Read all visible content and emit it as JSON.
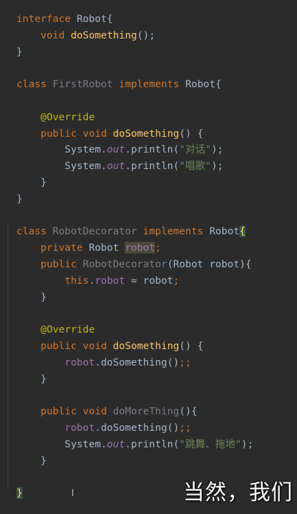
{
  "editor": {
    "lines": [
      [
        {
          "t": "interface",
          "c": "kw"
        },
        {
          "t": " Robot{",
          "c": "plain"
        }
      ],
      [
        {
          "t": "    ",
          "c": "plain"
        },
        {
          "t": "void",
          "c": "kw"
        },
        {
          "t": " ",
          "c": "plain"
        },
        {
          "t": "doSomething",
          "c": "fn"
        },
        {
          "t": "();",
          "c": "plain"
        }
      ],
      [
        {
          "t": "}",
          "c": "plain"
        }
      ],
      [],
      [
        {
          "t": "class",
          "c": "kw"
        },
        {
          "t": " ",
          "c": "plain"
        },
        {
          "t": "FirstRobot",
          "c": "unused"
        },
        {
          "t": " ",
          "c": "plain"
        },
        {
          "t": "implements",
          "c": "kw"
        },
        {
          "t": " Robot{",
          "c": "plain"
        }
      ],
      [],
      [
        {
          "t": "    ",
          "c": "plain"
        },
        {
          "t": "@Override",
          "c": "ann"
        }
      ],
      [
        {
          "t": "    ",
          "c": "plain"
        },
        {
          "t": "public",
          "c": "kw"
        },
        {
          "t": " ",
          "c": "plain"
        },
        {
          "t": "void",
          "c": "kw"
        },
        {
          "t": " ",
          "c": "plain"
        },
        {
          "t": "doSomething",
          "c": "fn"
        },
        {
          "t": "() {",
          "c": "plain"
        }
      ],
      [
        {
          "t": "        System.",
          "c": "plain"
        },
        {
          "t": "out",
          "c": "fld-i"
        },
        {
          "t": ".println(",
          "c": "plain"
        },
        {
          "t": "\"对话\"",
          "c": "str"
        },
        {
          "t": ");",
          "c": "plain"
        }
      ],
      [
        {
          "t": "        System.",
          "c": "plain"
        },
        {
          "t": "out",
          "c": "fld-i"
        },
        {
          "t": ".println(",
          "c": "plain"
        },
        {
          "t": "\"唱歌\"",
          "c": "str"
        },
        {
          "t": ");",
          "c": "plain"
        }
      ],
      [
        {
          "t": "    }",
          "c": "plain"
        }
      ],
      [
        {
          "t": "}",
          "c": "plain"
        }
      ],
      [],
      [
        {
          "t": "class",
          "c": "kw"
        },
        {
          "t": " ",
          "c": "plain"
        },
        {
          "t": "RobotDecorator",
          "c": "unused"
        },
        {
          "t": " ",
          "c": "plain"
        },
        {
          "t": "implements",
          "c": "kw"
        },
        {
          "t": " Robot",
          "c": "plain"
        },
        {
          "t": "{",
          "c": "caret-brace"
        }
      ],
      [
        {
          "t": "    ",
          "c": "plain"
        },
        {
          "t": "private",
          "c": "kw"
        },
        {
          "t": " Robot ",
          "c": "plain"
        },
        {
          "t": "robot",
          "c": "hl-field"
        },
        {
          "t": ";",
          "c": "kw"
        }
      ],
      [
        {
          "t": "    ",
          "c": "plain"
        },
        {
          "t": "public",
          "c": "kw"
        },
        {
          "t": " ",
          "c": "plain"
        },
        {
          "t": "RobotDecorator",
          "c": "unused"
        },
        {
          "t": "(Robot robot){",
          "c": "plain"
        }
      ],
      [
        {
          "t": "        ",
          "c": "plain"
        },
        {
          "t": "this",
          "c": "kw"
        },
        {
          "t": ".",
          "c": "plain"
        },
        {
          "t": "robot",
          "c": "fld"
        },
        {
          "t": " = robot",
          "c": "plain"
        },
        {
          "t": ";",
          "c": "kw"
        }
      ],
      [
        {
          "t": "    }",
          "c": "plain"
        }
      ],
      [],
      [
        {
          "t": "    ",
          "c": "plain"
        },
        {
          "t": "@Override",
          "c": "ann"
        }
      ],
      [
        {
          "t": "    ",
          "c": "plain"
        },
        {
          "t": "public",
          "c": "kw"
        },
        {
          "t": " ",
          "c": "plain"
        },
        {
          "t": "void",
          "c": "kw"
        },
        {
          "t": " ",
          "c": "plain"
        },
        {
          "t": "doSomething",
          "c": "fn"
        },
        {
          "t": "() {",
          "c": "plain"
        }
      ],
      [
        {
          "t": "        ",
          "c": "plain"
        },
        {
          "t": "robot",
          "c": "fld"
        },
        {
          "t": ".doSomething()",
          "c": "plain"
        },
        {
          "t": ";;",
          "c": "kw"
        }
      ],
      [
        {
          "t": "    }",
          "c": "plain"
        }
      ],
      [],
      [
        {
          "t": "    ",
          "c": "plain"
        },
        {
          "t": "public",
          "c": "kw"
        },
        {
          "t": " ",
          "c": "plain"
        },
        {
          "t": "void",
          "c": "kw"
        },
        {
          "t": " ",
          "c": "plain"
        },
        {
          "t": "doMoreThing",
          "c": "unused"
        },
        {
          "t": "(){",
          "c": "plain"
        }
      ],
      [
        {
          "t": "        ",
          "c": "plain"
        },
        {
          "t": "robot",
          "c": "fld"
        },
        {
          "t": ".doSomething()",
          "c": "plain"
        },
        {
          "t": ";;",
          "c": "kw"
        }
      ],
      [
        {
          "t": "        System.",
          "c": "plain"
        },
        {
          "t": "out",
          "c": "fld-i"
        },
        {
          "t": ".println(",
          "c": "plain"
        },
        {
          "t": "\"跳舞、拖地\"",
          "c": "str"
        },
        {
          "t": ");",
          "c": "plain"
        }
      ],
      [
        {
          "t": "    }",
          "c": "plain"
        }
      ],
      [],
      [
        {
          "t": "}",
          "c": "caret-brace"
        }
      ]
    ]
  },
  "cursor_glyph": "I",
  "subtitle": "当然，我们",
  "colors": {
    "background": "#2b2b2b",
    "keyword": "#cc7832",
    "function": "#ffc66d",
    "annotation": "#bbb529",
    "string": "#6a8759",
    "field": "#9876aa",
    "unused": "#7a7e85",
    "text": "#a9b7c6"
  }
}
